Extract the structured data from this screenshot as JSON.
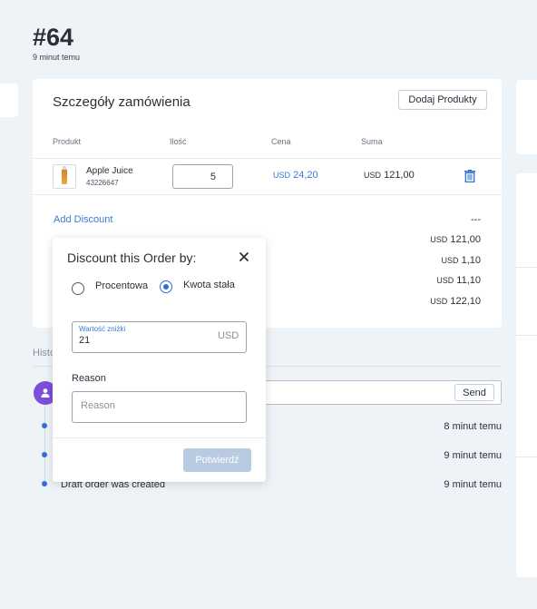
{
  "header": {
    "order_number": "#64",
    "order_time": "9 minut temu"
  },
  "order_details": {
    "title": "Szczegóły zamówienia",
    "add_products_label": "Dodaj Produkty",
    "columns": {
      "product": "Produkt",
      "quantity": "Ilość",
      "price": "Cena",
      "total": "Suma"
    },
    "line": {
      "name": "Apple Juice",
      "sku": "43226647",
      "quantity": "5",
      "price_currency": "USD",
      "price_value": "24,20",
      "total_currency": "USD",
      "total_value": "121,00"
    },
    "add_discount_label": "Add Discount",
    "discount_value": "---",
    "summary": [
      {
        "currency": "USD",
        "value": "121,00"
      },
      {
        "currency": "USD",
        "value": "1,10"
      },
      {
        "currency": "USD",
        "value": "11,10"
      },
      {
        "currency": "USD",
        "value": "122,10"
      }
    ]
  },
  "history": {
    "label": "Histo",
    "send_label": "Send",
    "events": [
      {
        "text": "",
        "time": "8 minut temu"
      },
      {
        "text": "",
        "time": "9 minut temu"
      },
      {
        "text": "Draft order was created",
        "time": "9 minut temu"
      }
    ]
  },
  "discount_popup": {
    "title": "Discount this Order by:",
    "option_percent": "Procentowa",
    "option_fixed": "Kwota stała",
    "selected": "fixed",
    "value_label": "Wartość zniżki",
    "value": "21",
    "value_currency": "USD",
    "reason_label": "Reason",
    "reason_placeholder": "Reason",
    "confirm_label": "Potwierdź"
  },
  "colors": {
    "accent": "#2f6fd8",
    "link": "#3a7bd5",
    "avatar": "#7d4ed8",
    "disabled_button": "#b8cbe3",
    "background": "#eef3f7"
  },
  "icons": [
    "trash-icon",
    "close-icon",
    "user-icon"
  ]
}
